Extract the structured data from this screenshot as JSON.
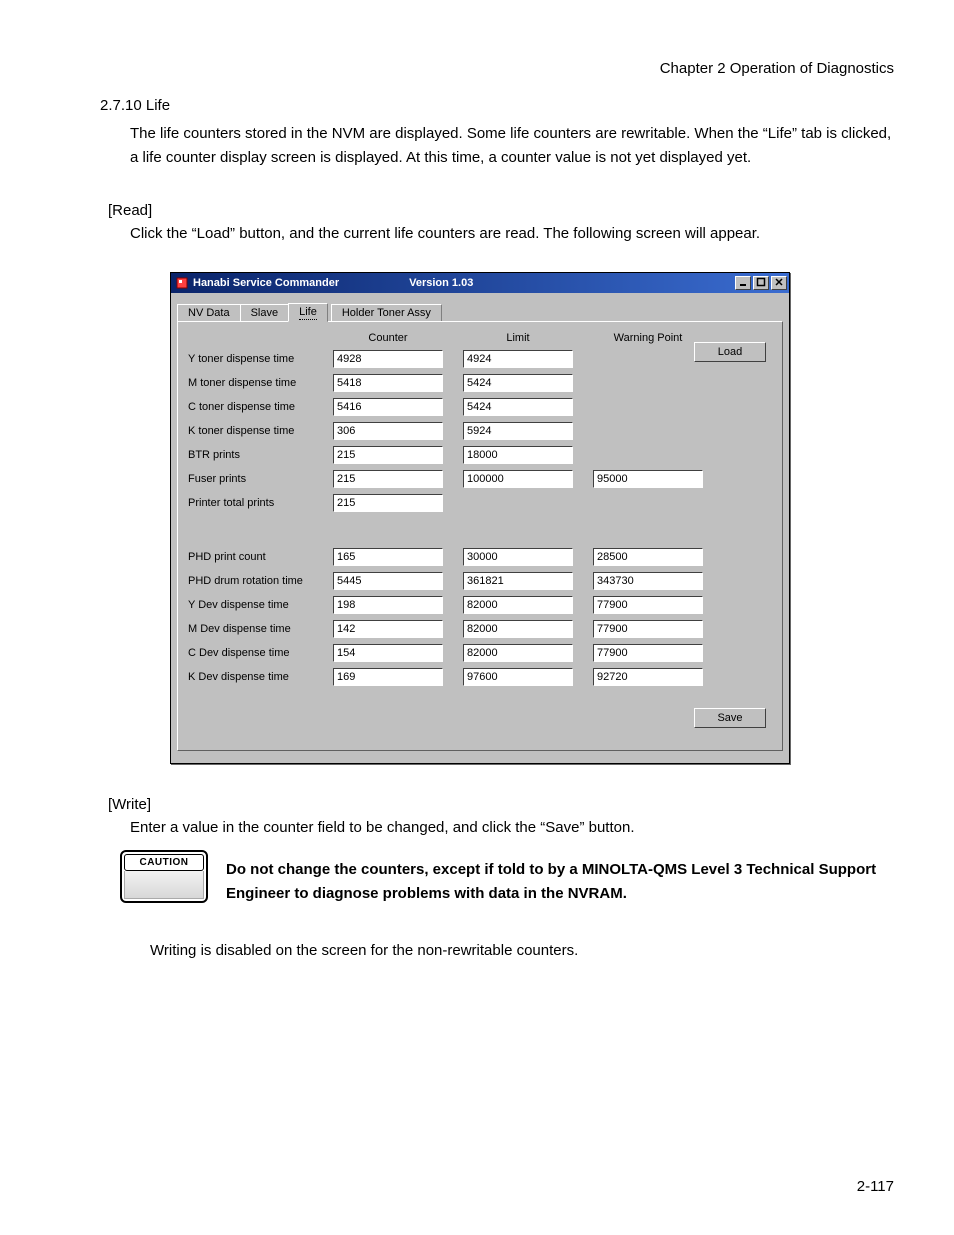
{
  "chapter_header": "Chapter 2  Operation of Diagnostics",
  "section_heading": "2.7.10 Life",
  "body_text": "The life counters stored in the NVM are displayed. Some life counters are rewritable. When the “Life” tab is clicked, a life counter display screen is displayed. At this time, a counter value is not yet displayed yet.",
  "read_heading": "[Read]",
  "read_body": "Click the “Load” button, and the current life counters are read. The following screen will appear.",
  "window": {
    "title": "Hanabi Service Commander",
    "version": "Version 1.03",
    "tabs": [
      "NV Data",
      "Slave",
      "Life",
      "Holder Toner Assy"
    ],
    "active_tab": 2,
    "headers": {
      "counter": "Counter",
      "limit": "Limit",
      "warning": "Warning Point"
    },
    "rows_top": [
      {
        "label": "Y toner dispense time",
        "counter": "4928",
        "limit": "4924",
        "warning": ""
      },
      {
        "label": "M toner dispense time",
        "counter": "5418",
        "limit": "5424",
        "warning": ""
      },
      {
        "label": "C toner dispense time",
        "counter": "5416",
        "limit": "5424",
        "warning": ""
      },
      {
        "label": "K toner dispense time",
        "counter": "306",
        "limit": "5924",
        "warning": ""
      },
      {
        "label": "BTR prints",
        "counter": "215",
        "limit": "18000",
        "warning": ""
      },
      {
        "label": "Fuser prints",
        "counter": "215",
        "limit": "100000",
        "warning": "95000"
      },
      {
        "label": "Printer total prints",
        "counter": "215",
        "limit": "",
        "warning": ""
      }
    ],
    "rows_bottom": [
      {
        "label": "PHD print count",
        "counter": "165",
        "limit": "30000",
        "warning": "28500"
      },
      {
        "label": "PHD drum rotation time",
        "counter": "5445",
        "limit": "361821",
        "warning": "343730"
      },
      {
        "label": "Y Dev dispense time",
        "counter": "198",
        "limit": "82000",
        "warning": "77900"
      },
      {
        "label": "M Dev dispense time",
        "counter": "142",
        "limit": "82000",
        "warning": "77900"
      },
      {
        "label": "C Dev dispense time",
        "counter": "154",
        "limit": "82000",
        "warning": "77900"
      },
      {
        "label": "K Dev dispense time",
        "counter": "169",
        "limit": "97600",
        "warning": "92720"
      }
    ],
    "buttons": {
      "load": "Load",
      "save": "Save"
    }
  },
  "write_heading": "[Write]",
  "write_body": "Enter a value in the counter field to be changed, and click the “Save” button.",
  "caution_label": "CAUTION",
  "caution_text": "Do not change the counters, except if told to by a MINOLTA-QMS Level 3 Technical Support Engineer to diagnose problems with data in the NVRAM.",
  "after_caution": "Writing is disabled on the screen for the non-rewritable counters.",
  "page_number": "2-117"
}
